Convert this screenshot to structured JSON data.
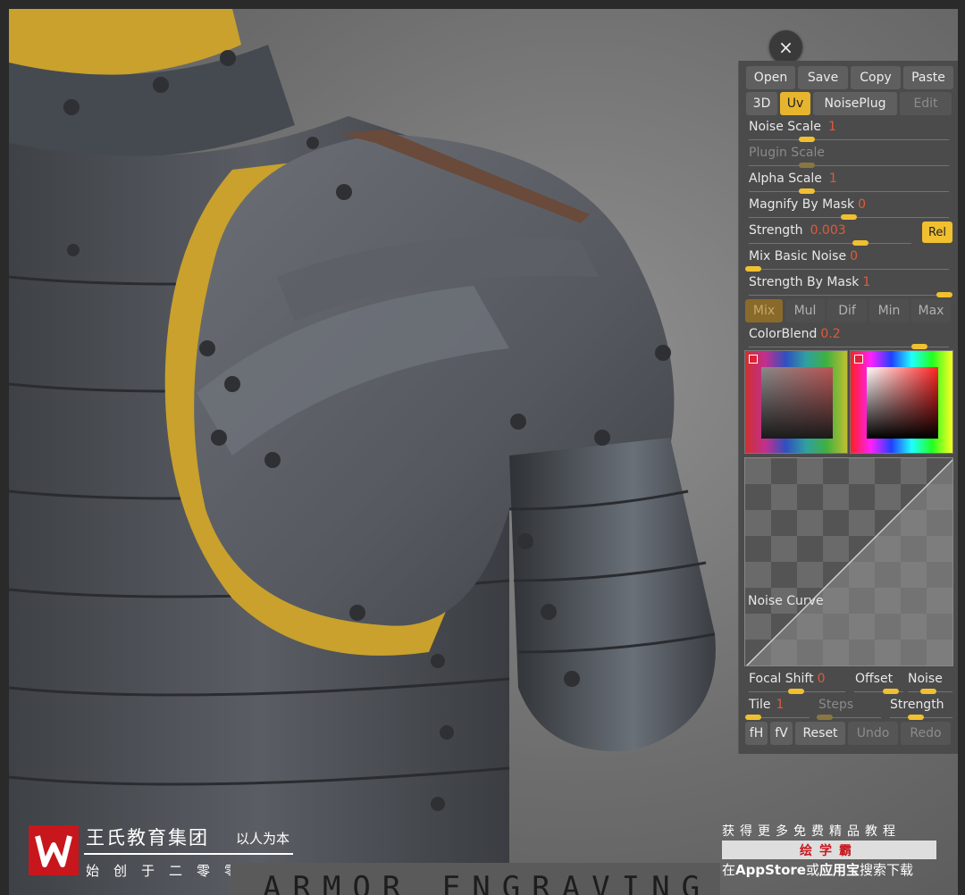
{
  "panel": {
    "top_buttons": [
      "Open",
      "Save",
      "Copy",
      "Paste"
    ],
    "mode_buttons": [
      "3D",
      "Uv",
      "NoisePlug",
      "Edit"
    ],
    "sliders": [
      {
        "label": "Noise Scale",
        "value": "1"
      },
      {
        "label": "Plugin Scale",
        "value": ""
      },
      {
        "label": "Alpha Scale",
        "value": "1"
      },
      {
        "label": "Magnify By Mask",
        "value": "0"
      },
      {
        "label": "Strength",
        "value": "0.003"
      },
      {
        "label": "Mix Basic Noise",
        "value": "0"
      },
      {
        "label": "Strength By Mask",
        "value": "1"
      }
    ],
    "rel_label": "Rel",
    "blend_buttons": [
      "Mix",
      "Mul",
      "Dif",
      "Min",
      "Max"
    ],
    "colorblend": {
      "label": "ColorBlend",
      "value": "0.2"
    },
    "noise_curve_label": "Noise Curve",
    "focal_shift": {
      "label": "Focal Shift",
      "value": "0"
    },
    "offset_label": "Offset",
    "noise_label": "Noise",
    "tile": {
      "label": "Tile",
      "value": "1"
    },
    "steps_label": "Steps",
    "strength_label": "Strength",
    "bottom_buttons": [
      "fH",
      "fV",
      "Reset",
      "Undo",
      "Redo"
    ]
  },
  "close_symbol": "×",
  "watermark": {
    "org": "王氏教育集团",
    "motto": "以人为本",
    "founded": "始创于二零零二年",
    "course_title": "ARMOR ENGRAVING",
    "promo_line1": "获得更多免费精品教程",
    "promo_brand": "绘学霸",
    "promo_line2_a": "在",
    "promo_line2_b": "AppStore",
    "promo_line2_c": "或",
    "promo_line2_d": "应用宝",
    "promo_line2_e": "搜索下载"
  },
  "colors": {
    "accent": "#f0c030",
    "value_red": "#e05a3a",
    "panel_bg": "#4b4b4b",
    "brand_red": "#c8161d"
  }
}
